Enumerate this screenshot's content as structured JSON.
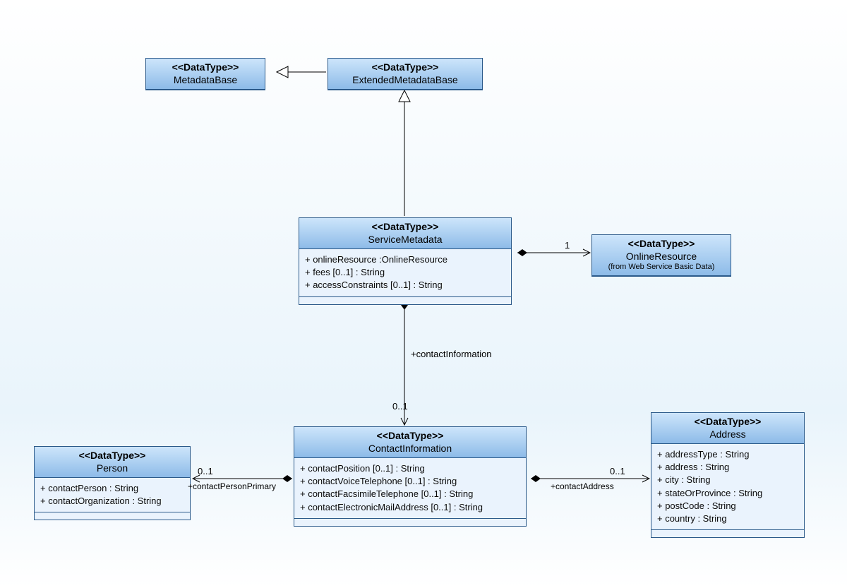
{
  "stereotype": "<<DataType>>",
  "classes": {
    "metadataBase": {
      "name": "MetadataBase"
    },
    "extendedMetadataBase": {
      "name": "ExtendedMetadataBase"
    },
    "serviceMetadata": {
      "name": "ServiceMetadata",
      "attrs": [
        "+ onlineResource :OnlineResource",
        "+ fees [0..1] : String",
        "+ accessConstraints [0..1] : String"
      ]
    },
    "onlineResource": {
      "name": "OnlineResource",
      "note": "(from Web Service Basic Data)"
    },
    "contactInformation": {
      "name": "ContactInformation",
      "attrs": [
        "+ contactPosition [0..1] : String",
        "+ contactVoiceTelephone [0..1] : String",
        "+ contactFacsimileTelephone [0..1] : String",
        "+ contactElectronicMailAddress [0..1] : String"
      ]
    },
    "person": {
      "name": "Person",
      "attrs": [
        "+ contactPerson : String",
        "+ contactOrganization : String"
      ]
    },
    "address": {
      "name": "Address",
      "attrs": [
        "+ addressType : String",
        "+ address : String",
        "+ city : String",
        "+ stateOrProvince : String",
        "+ postCode : String",
        "+ country : String"
      ]
    }
  },
  "relations": {
    "metadataBase_extendedMetadataBase": {
      "type": "generalization"
    },
    "extendedMetadataBase_serviceMetadata": {
      "type": "generalization"
    },
    "serviceMetadata_onlineResource": {
      "type": "composition",
      "multiplicity_target": "1"
    },
    "serviceMetadata_contactInformation": {
      "type": "composition",
      "role": "+contactInformation",
      "multiplicity_target": "0..1"
    },
    "contactInformation_person": {
      "type": "composition",
      "role": "+contactPersonPrimary",
      "multiplicity_target": "0..1"
    },
    "contactInformation_address": {
      "type": "composition",
      "role": "+contactAddress",
      "multiplicity_target": "0..1"
    }
  }
}
